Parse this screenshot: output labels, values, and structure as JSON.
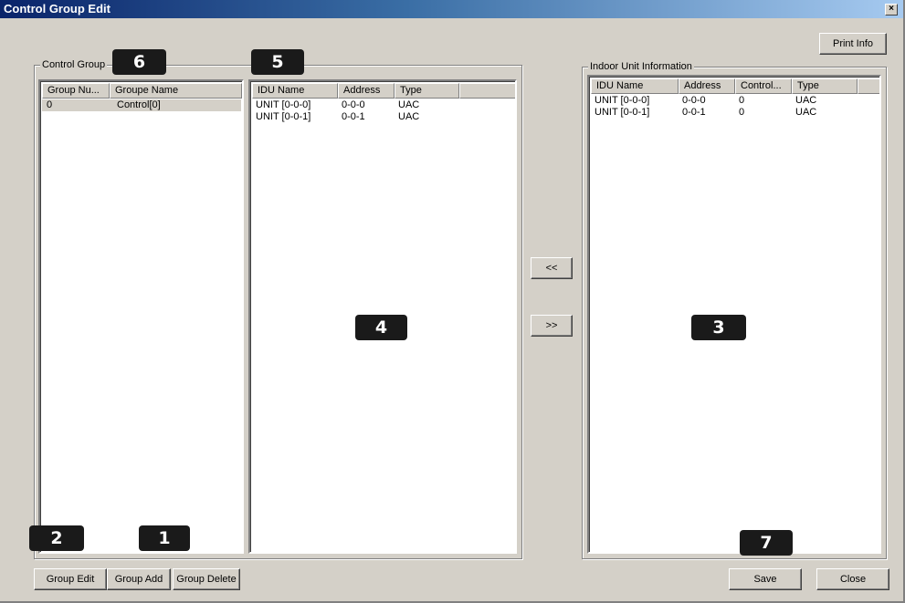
{
  "window": {
    "title": "Control Group Edit",
    "close_glyph": "×"
  },
  "buttons": {
    "print_info": "Print Info",
    "move_left": "<<",
    "move_right": ">>",
    "group_edit": "Group Edit",
    "group_add": "Group Add",
    "group_delete": "Group Delete",
    "save": "Save",
    "close": "Close"
  },
  "control_group": {
    "label": "Control Group",
    "columns": [
      "Group Nu...",
      "Groupe Name"
    ],
    "rows": [
      [
        "0",
        "Control[0]"
      ]
    ]
  },
  "group_members": {
    "columns": [
      "IDU Name",
      "Address",
      "Type"
    ],
    "rows": [
      [
        "UNIT [0-0-0]",
        "0-0-0",
        "UAC"
      ],
      [
        "UNIT [0-0-1]",
        "0-0-1",
        "UAC"
      ]
    ]
  },
  "indoor_units": {
    "label": "Indoor Unit Information",
    "columns": [
      "IDU Name",
      "Address",
      "Control...",
      "Type"
    ],
    "rows": [
      [
        "UNIT [0-0-0]",
        "0-0-0",
        "0",
        "UAC"
      ],
      [
        "UNIT [0-0-1]",
        "0-0-1",
        "0",
        "UAC"
      ]
    ]
  },
  "badges": [
    "1",
    "2",
    "3",
    "4",
    "5",
    "6",
    "7"
  ],
  "colors": {
    "titlebar_start": "#0a246a",
    "titlebar_end": "#a6caf0",
    "face": "#d4d0c8",
    "selected_row": "#d4d0c8",
    "badge": "#1a1a1a"
  }
}
